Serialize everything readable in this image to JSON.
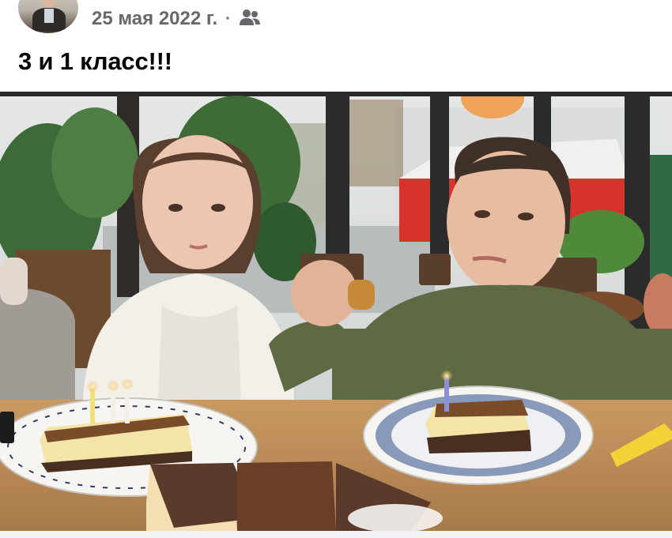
{
  "post": {
    "date": "25 мая 2022 г.",
    "separator": "·",
    "privacy_icon": "friends-icon",
    "text": "3 и 1 класс!!!"
  },
  "photo": {
    "subject": "two-children-birthday-cakes"
  }
}
